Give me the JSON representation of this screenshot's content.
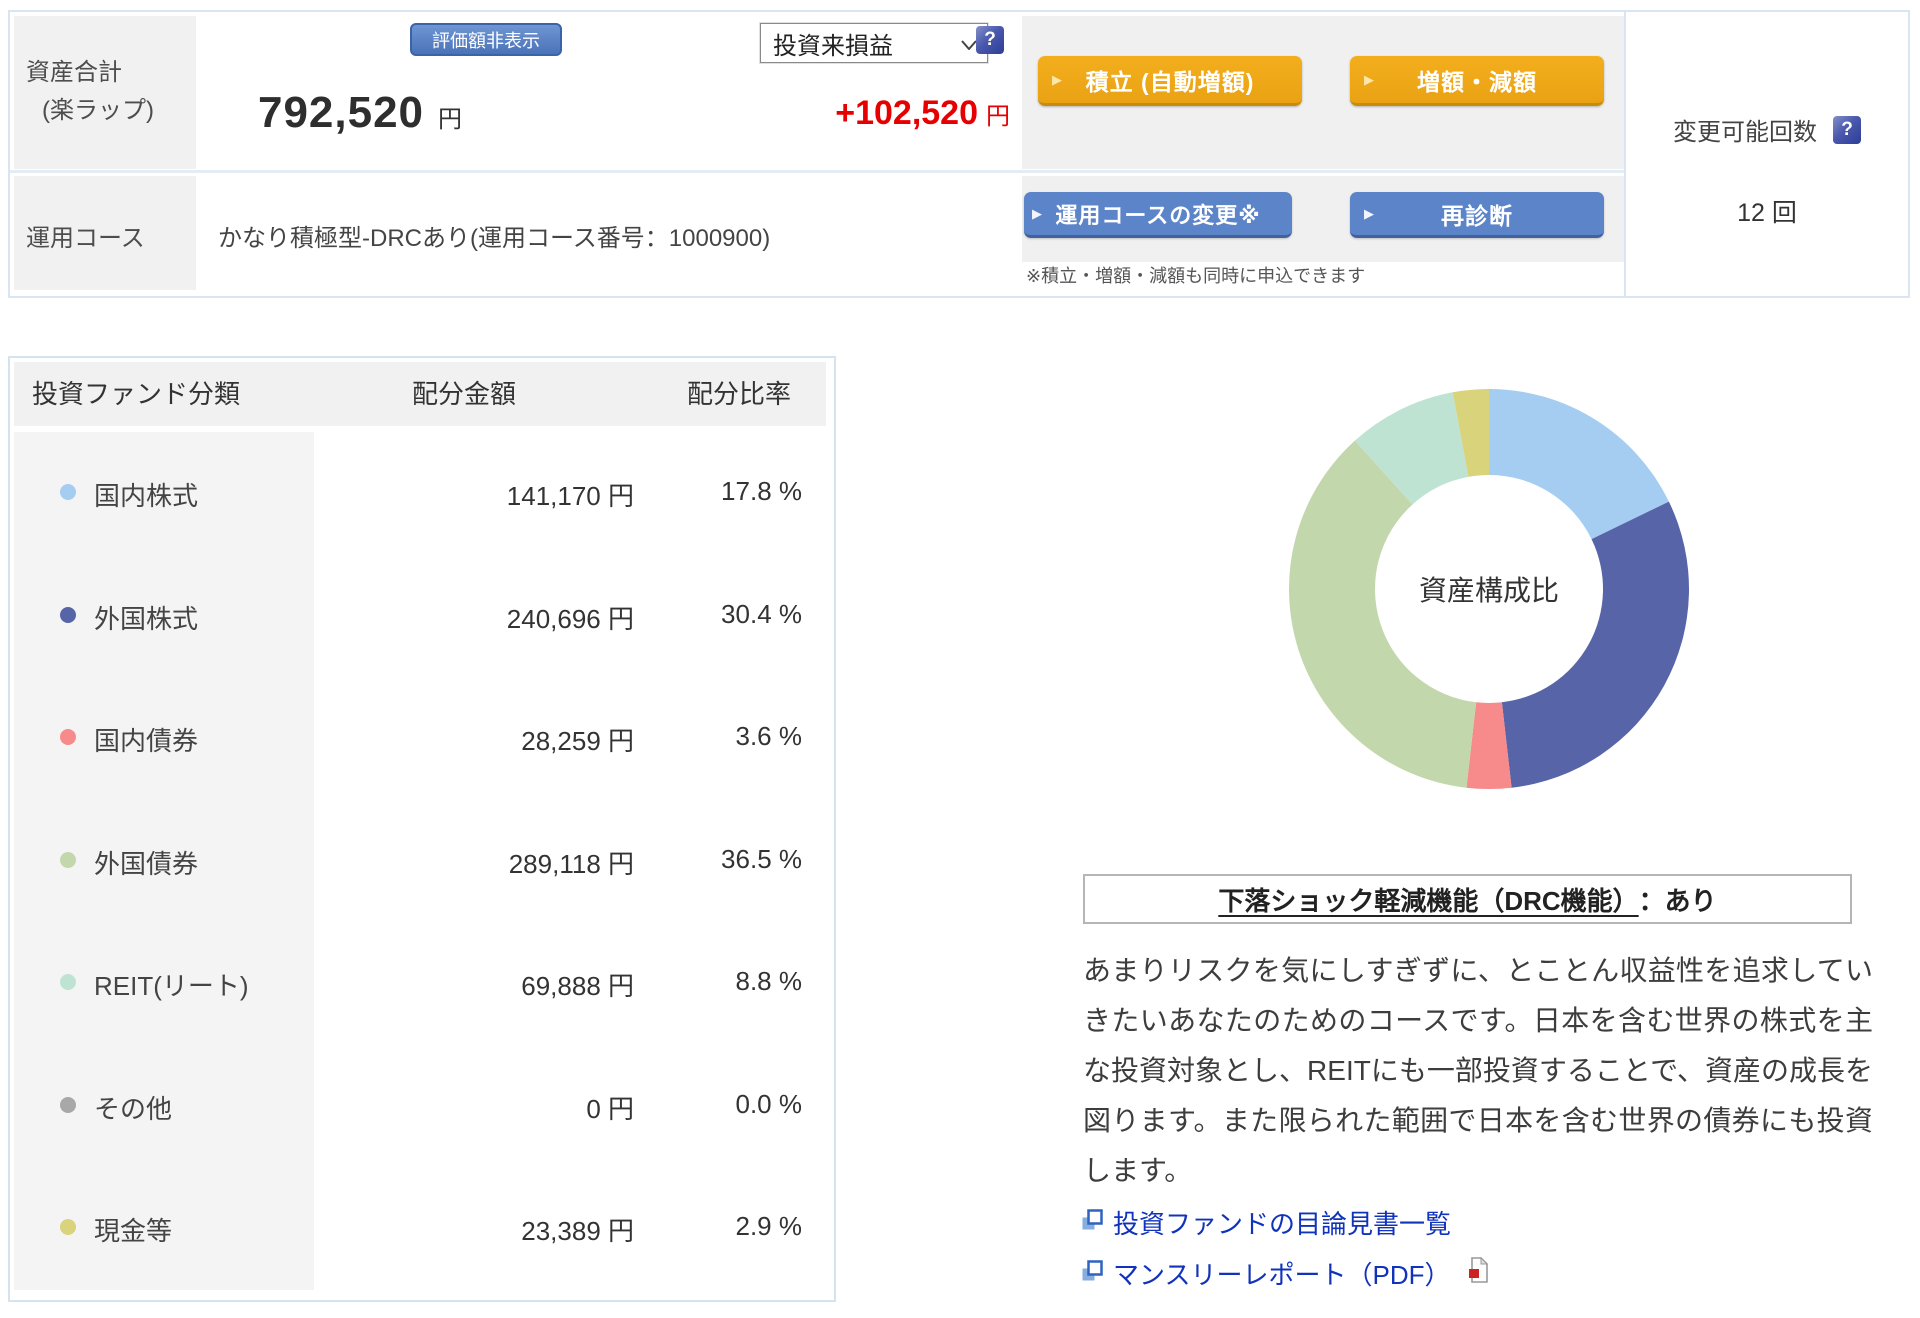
{
  "icons": {
    "help": "?"
  },
  "top": {
    "asset_label_line1": "資産合計",
    "asset_label_line2": "(楽ラップ)",
    "hide_value_button": "評価額非表示",
    "total_amount": "792,520",
    "total_unit": "円",
    "pl_select_value": "投資来損益",
    "pl_value": "+102,520",
    "pl_unit": "円",
    "tsumitate_button": "積立 (自動増額)",
    "zougaku_button": "増額・減額",
    "course_label": "運用コース",
    "course_value": "かなり積極型-DRCあり(運用コース番号：1000900)",
    "course_change_button": "運用コースの変更※",
    "rediagnosis_button": "再診断",
    "note": "※積立・増額・減額も同時に申込できます",
    "change_count_label": "変更可能回数",
    "change_count_value": "12 回"
  },
  "table": {
    "headers": [
      "投資ファンド分類",
      "配分金額",
      "配分比率"
    ],
    "rows": [
      {
        "label": "国内株式",
        "amount": "141,170 円",
        "ratio": "17.8 %",
        "color": "#a5cdf2"
      },
      {
        "label": "外国株式",
        "amount": "240,696 円",
        "ratio": "30.4 %",
        "color": "#5765a8"
      },
      {
        "label": "国内債券",
        "amount": "28,259 円",
        "ratio": "3.6 %",
        "color": "#f78b8b"
      },
      {
        "label": "外国債券",
        "amount": "289,118 円",
        "ratio": "36.5 %",
        "color": "#c3d7ad"
      },
      {
        "label": "REIT(リート)",
        "amount": "69,888 円",
        "ratio": "8.8 %",
        "color": "#bfe3d2"
      },
      {
        "label": "その他",
        "amount": "0 円",
        "ratio": "0.0 %",
        "color": "#a8a8a8"
      },
      {
        "label": "現金等",
        "amount": "23,389 円",
        "ratio": "2.9 %",
        "color": "#d9d37c"
      }
    ]
  },
  "chart_data": {
    "type": "pie",
    "subtype": "donut",
    "title": "資産構成比",
    "unit": "%",
    "start_angle_deg": 0,
    "direction": "clockwise",
    "segments": [
      {
        "label": "国内株式",
        "value": 17.8,
        "color": "#a5cdf2"
      },
      {
        "label": "外国株式",
        "value": 30.4,
        "color": "#5765a8"
      },
      {
        "label": "国内債券",
        "value": 3.6,
        "color": "#f78b8b"
      },
      {
        "label": "外国債券",
        "value": 36.5,
        "color": "#c3d7ad"
      },
      {
        "label": "REIT(リート)",
        "value": 8.8,
        "color": "#bfe3d2"
      },
      {
        "label": "その他",
        "value": 0.0,
        "color": "#a8a8a8"
      },
      {
        "label": "現金等",
        "value": 2.9,
        "color": "#d9d37c"
      }
    ]
  },
  "drc": {
    "title_underline": "下落ショック軽減機能（DRC機能）",
    "title_rest": "：あり"
  },
  "description": "あまりリスクを気にしすぎずに、とことん収益性を追求していきたいあなたのためのコースです。日本を含む世界の株式を主な投資対象とし、REITにも一部投資することで、資産の成長を図ります。また限られた範囲で日本を含む世界の債券にも投資します。",
  "links": [
    {
      "label": "投資ファンドの目論見書一覧"
    },
    {
      "label": "マンスリーレポート（PDF）"
    }
  ],
  "colors": {
    "accent_orange": "#efa714",
    "accent_blue": "#5b84c9",
    "pl_red": "#e60000",
    "link_blue": "#1133bb",
    "panel_border": "#d9e5f0"
  }
}
